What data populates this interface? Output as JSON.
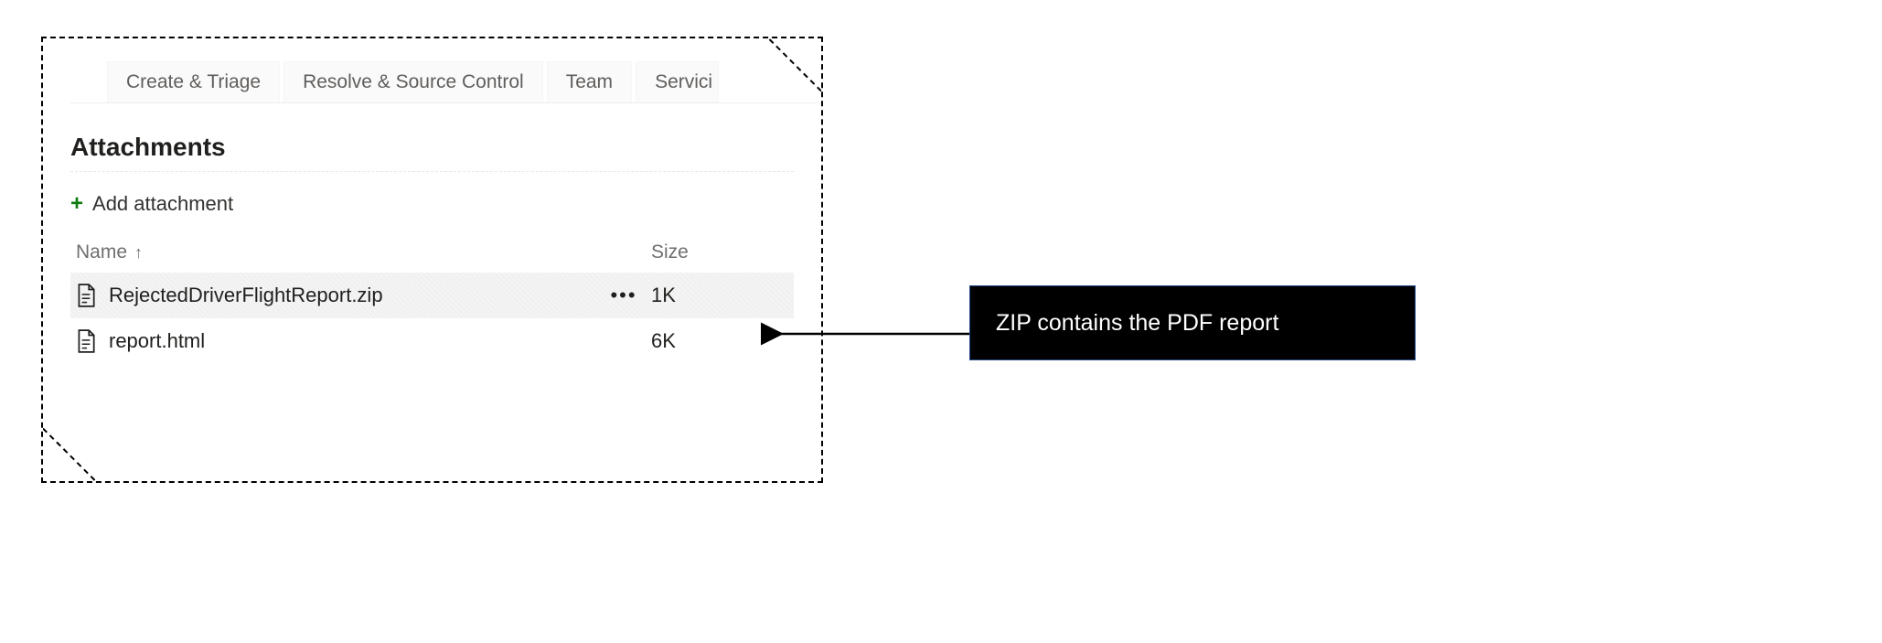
{
  "tabs": [
    "Create & Triage",
    "Resolve & Source Control",
    "Team",
    "Servici"
  ],
  "section_title": "Attachments",
  "add_label": "Add attachment",
  "columns": {
    "name": "Name",
    "size": "Size"
  },
  "sort_direction": "asc",
  "rows": [
    {
      "file": "RejectedDriverFlightReport.zip",
      "size": "1K",
      "selected": true,
      "has_menu": true
    },
    {
      "file": "report.html",
      "size": "6K",
      "selected": false,
      "has_menu": false
    }
  ],
  "callout": "ZIP contains the PDF report",
  "ellipsis": "•••"
}
